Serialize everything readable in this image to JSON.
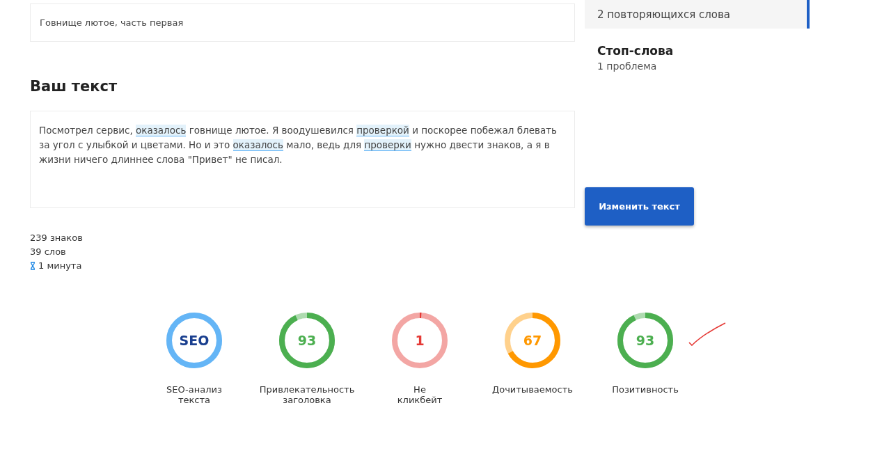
{
  "title_field": {
    "value": "Говнище лютое, часть первая"
  },
  "text_section": {
    "heading": "Ваш текст",
    "segments": [
      {
        "text": "Посмотрел сервис, ",
        "highlighted": false
      },
      {
        "text": "оказалось",
        "highlighted": true
      },
      {
        "text": " говнище лютое. Я воодушевился ",
        "highlighted": false
      },
      {
        "text": "проверкой",
        "highlighted": true
      },
      {
        "text": " и поскорее побежал блевать за угол с улыбкой и цветами. Но и это ",
        "highlighted": false
      },
      {
        "text": "оказалось",
        "highlighted": true
      },
      {
        "text": " мало, ведь для ",
        "highlighted": false
      },
      {
        "text": "проверки",
        "highlighted": true
      },
      {
        "text": " нужно двести знаков, а я в жизни ничего длиннее слова \"Привет\" не писал.",
        "highlighted": false
      }
    ]
  },
  "stats": {
    "chars": "239 знаков",
    "words": "39 слов",
    "reading_time": "1 минута"
  },
  "sidebar": {
    "items": [
      {
        "kind": "active",
        "label": "2 повторяющихся слова",
        "selected": true
      },
      {
        "kind": "section",
        "title": "Стоп-слова",
        "label": "1 проблема",
        "selected": false
      }
    ]
  },
  "edit_button": "Изменить текст",
  "gauges": [
    {
      "kind": "seo",
      "value": "SEO",
      "label": "SEO-анализ текста",
      "level": 1,
      "color": "#64b5f6"
    },
    {
      "kind": "score",
      "value": "93",
      "label": "Привлекательность заголовка",
      "level": 0.93,
      "color": "#4caf50"
    },
    {
      "kind": "score",
      "value": "1",
      "label": "Не кликбейт",
      "level": 0.01,
      "color": "#e53935"
    },
    {
      "kind": "score",
      "value": "67",
      "label": "Дочитываемость",
      "level": 0.67,
      "color": "#ff9800"
    },
    {
      "kind": "score",
      "value": "93",
      "label": "Позитивность",
      "level": 0.93,
      "color": "#4caf50"
    }
  ]
}
